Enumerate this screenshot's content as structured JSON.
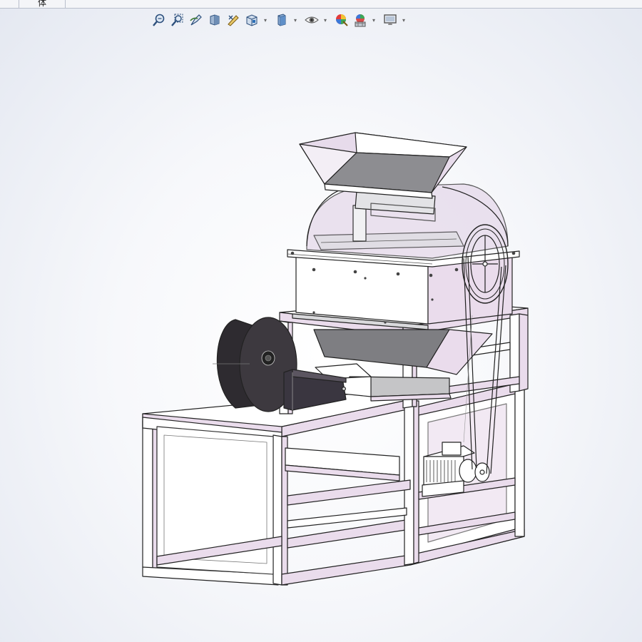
{
  "document_tab": {
    "label": "体"
  },
  "toolbar": {
    "buttons": [
      {
        "icon": "zoom-to-fit-icon",
        "dropdown": false
      },
      {
        "icon": "zoom-to-area-icon",
        "dropdown": false
      },
      {
        "icon": "previous-view-icon",
        "dropdown": false
      },
      {
        "icon": "section-view-icon",
        "dropdown": false
      },
      {
        "icon": "dynamic-annotation-icon",
        "dropdown": false
      },
      {
        "icon": "view-orientation-icon",
        "dropdown": true
      },
      {
        "icon": "display-style-icon",
        "dropdown": true
      },
      {
        "icon": "hide-show-items-icon",
        "dropdown": true
      },
      {
        "icon": "edit-appearance-icon",
        "dropdown": false
      },
      {
        "icon": "apply-scene-icon",
        "dropdown": true
      },
      {
        "icon": "view-settings-icon",
        "dropdown": true
      }
    ]
  },
  "model": {
    "name": "3d-assembly-model"
  },
  "colors": {
    "frame_face": "#ffffff",
    "frame_side": "#eadcec",
    "edge": "#222222",
    "glass": "#e5d9ea",
    "fan": "#3c383c",
    "hopper_inside": "#8d8d91"
  }
}
